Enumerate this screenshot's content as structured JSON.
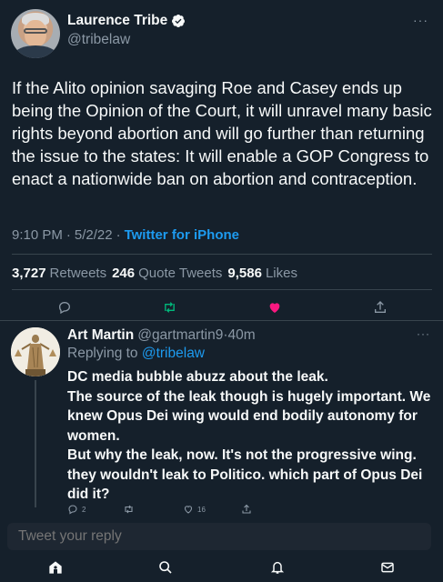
{
  "main_tweet": {
    "author_name": "Laurence Tribe",
    "author_handle": "@tribelaw",
    "more_glyph": "···",
    "text": "If the Alito opinion savaging Roe and Casey ends up being the Opinion of the Court, it will unravel many basic rights beyond abortion and will go further than returning the issue to the states: It will enable a GOP Congress to enact a nationwide ban on abortion and contraception.",
    "time": "9:10 PM",
    "date": "5/2/22",
    "separator": "·",
    "source": "Twitter for iPhone",
    "stats": {
      "retweets_count": "3,727",
      "retweets_label": "Retweets",
      "quote_count": "246",
      "quote_label": "Quote Tweets",
      "likes_count": "9,586",
      "likes_label": "Likes"
    },
    "liked": true
  },
  "reply": {
    "author_name": "Art Martin",
    "author_handle": "@gartmartin9",
    "separator": "·",
    "time_ago": "40m",
    "more_glyph": "···",
    "replying_label": "Replying to",
    "replying_to": "@tribelaw",
    "text": "DC media bubble abuzz about the leak.\nThe source of the leak though is hugely important. We knew Opus Dei wing would end bodily autonomy for women.\nBut why the leak, now. It's not the progressive wing. they wouldn't leak to Politico. which part of Opus Dei did it?",
    "reply_count": "2",
    "like_count": "16"
  },
  "composer": {
    "placeholder": "Tweet your reply"
  },
  "bottom_nav": [
    "home-icon",
    "search-icon",
    "notifications-icon",
    "messages-icon"
  ],
  "colors": {
    "background": "#15202b",
    "accent": "#1d9bf0",
    "like": "#f91880",
    "retweet": "#00ba7c",
    "muted": "#8b98a5",
    "divider": "#38444d"
  }
}
